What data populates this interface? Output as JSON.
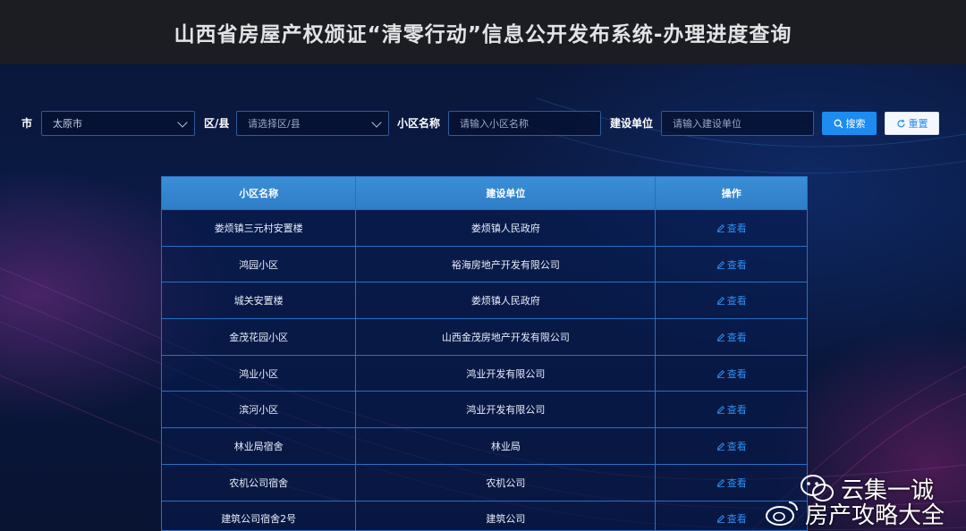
{
  "header": {
    "title": "山西省房屋产权颁证“清零行动”信息公开发布系统-办理进度查询"
  },
  "filters": {
    "city_label": "市",
    "city_value": "太原市",
    "district_label": "区/县",
    "district_placeholder": "请选择区/县",
    "community_label": "小区名称",
    "community_placeholder": "请输入小区名称",
    "builder_label": "建设单位",
    "builder_placeholder": "请输入建设单位",
    "search_label": "搜索",
    "reset_label": "重置"
  },
  "table": {
    "columns": [
      "小区名称",
      "建设单位",
      "操作"
    ],
    "rows": [
      {
        "community": "娄烦镇三元村安置楼",
        "builder": "娄烦镇人民政府",
        "action": "查看"
      },
      {
        "community": "鸿园小区",
        "builder": "裕海房地产开发有限公司",
        "action": "查看"
      },
      {
        "community": "城关安置楼",
        "builder": "娄烦镇人民政府",
        "action": "查看"
      },
      {
        "community": "金茂花园小区",
        "builder": "山西金茂房地产开发有限公司",
        "action": "查看"
      },
      {
        "community": "鸿业小区",
        "builder": "鸿业开发有限公司",
        "action": "查看"
      },
      {
        "community": "滨河小区",
        "builder": "鸿业开发有限公司",
        "action": "查看"
      },
      {
        "community": "林业局宿舍",
        "builder": "林业局",
        "action": "查看"
      },
      {
        "community": "农机公司宿舍",
        "builder": "农机公司",
        "action": "查看"
      },
      {
        "community": "建筑公司宿舍2号",
        "builder": "建筑公司",
        "action": "查看"
      }
    ]
  },
  "watermark": {
    "line1": "云集一诚",
    "line2": "房产攻略大全"
  },
  "colors": {
    "accent": "#1d8cf0",
    "table_header": "#3a8fd6",
    "header_bg": "#1b1d22"
  }
}
